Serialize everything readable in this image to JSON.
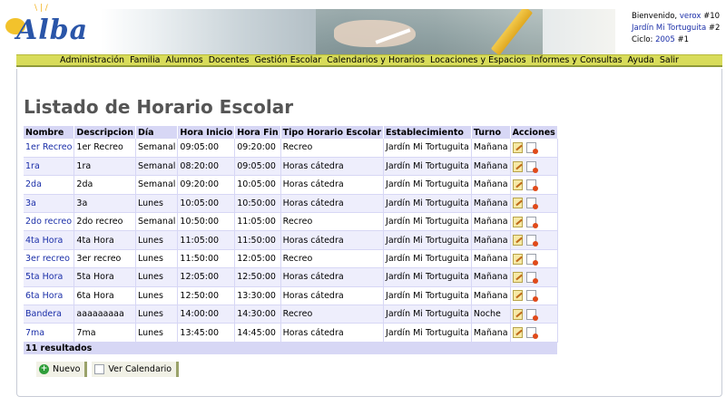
{
  "header": {
    "logo_text": "Alba",
    "welcome_prefix": "Bienvenido,",
    "user": "verox",
    "user_id": "#10",
    "school": "Jardín Mi Tortuguita",
    "school_id": "#2",
    "cycle_prefix": "Ciclo:",
    "cycle": "2005",
    "cycle_id": "#1"
  },
  "menu": [
    "Administración",
    "Familia",
    "Alumnos",
    "Docentes",
    "Gestión Escolar",
    "Calendarios y Horarios",
    "Locaciones y Espacios",
    "Informes y Consultas",
    "Ayuda",
    "Salir"
  ],
  "page_title": "Listado de Horario Escolar",
  "table": {
    "columns": [
      "Nombre",
      "Descripcion",
      "Día",
      "Hora Inicio",
      "Hora Fin",
      "Tipo Horario Escolar",
      "Establecimiento",
      "Turno",
      "Acciones"
    ],
    "rows": [
      [
        "1er Recreo",
        "1er Recreo",
        "Semanal",
        "09:05:00",
        "09:20:00",
        "Recreo",
        "Jardín Mi Tortuguita",
        "Mañana"
      ],
      [
        "1ra",
        "1ra",
        "Semanal",
        "08:20:00",
        "09:05:00",
        "Horas cátedra",
        "Jardín Mi Tortuguita",
        "Mañana"
      ],
      [
        "2da",
        "2da",
        "Semanal",
        "09:20:00",
        "10:05:00",
        "Horas cátedra",
        "Jardín Mi Tortuguita",
        "Mañana"
      ],
      [
        "3a",
        "3a",
        "Lunes",
        "10:05:00",
        "10:50:00",
        "Horas cátedra",
        "Jardín Mi Tortuguita",
        "Mañana"
      ],
      [
        "2do recreo",
        "2do recreo",
        "Semanal",
        "10:50:00",
        "11:05:00",
        "Recreo",
        "Jardín Mi Tortuguita",
        "Mañana"
      ],
      [
        "4ta Hora",
        "4ta Hora",
        "Lunes",
        "11:05:00",
        "11:50:00",
        "Horas cátedra",
        "Jardín Mi Tortuguita",
        "Mañana"
      ],
      [
        "3er recreo",
        "3er recreo",
        "Lunes",
        "11:50:00",
        "12:05:00",
        "Recreo",
        "Jardín Mi Tortuguita",
        "Mañana"
      ],
      [
        "5ta Hora",
        "5ta Hora",
        "Lunes",
        "12:05:00",
        "12:50:00",
        "Horas cátedra",
        "Jardín Mi Tortuguita",
        "Mañana"
      ],
      [
        "6ta Hora",
        "6ta Hora",
        "Lunes",
        "12:50:00",
        "13:30:00",
        "Horas cátedra",
        "Jardín Mi Tortuguita",
        "Mañana"
      ],
      [
        "Bandera",
        "aaaaaaaaa",
        "Lunes",
        "14:00:00",
        "14:30:00",
        "Recreo",
        "Jardín Mi Tortuguita",
        "Noche"
      ],
      [
        "7ma",
        "7ma",
        "Lunes",
        "13:45:00",
        "14:45:00",
        "Horas cátedra",
        "Jardín Mi Tortuguita",
        "Mañana"
      ]
    ],
    "footer": "11 resultados"
  },
  "buttons": {
    "new_label": "Nuevo",
    "calendar_label": "Ver Calendario"
  },
  "icons": {
    "edit": "edit-icon",
    "delete": "delete-icon",
    "add": "plus-circle-icon",
    "calendar": "document-icon"
  },
  "colors": {
    "menu_bar": "#d8dc5a",
    "table_header": "#d7d7f5",
    "link": "#1a2ea8",
    "title": "#555555"
  }
}
